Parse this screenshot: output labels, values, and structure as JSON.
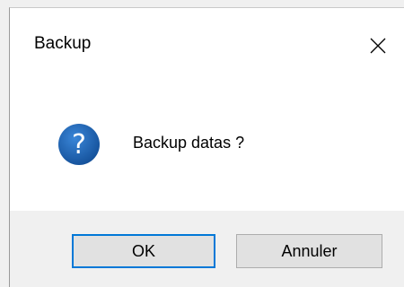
{
  "dialog": {
    "title": "Backup",
    "message": "Backup datas ?",
    "close_icon": "close-icon",
    "message_icon": "question-icon",
    "buttons": {
      "ok_label": "OK",
      "cancel_label": "Annuler"
    }
  },
  "colors": {
    "accent": "#0078d7",
    "icon_blue": "#1c5ca8",
    "footer_bg": "#f0f0f0",
    "button_bg": "#e1e1e1"
  }
}
